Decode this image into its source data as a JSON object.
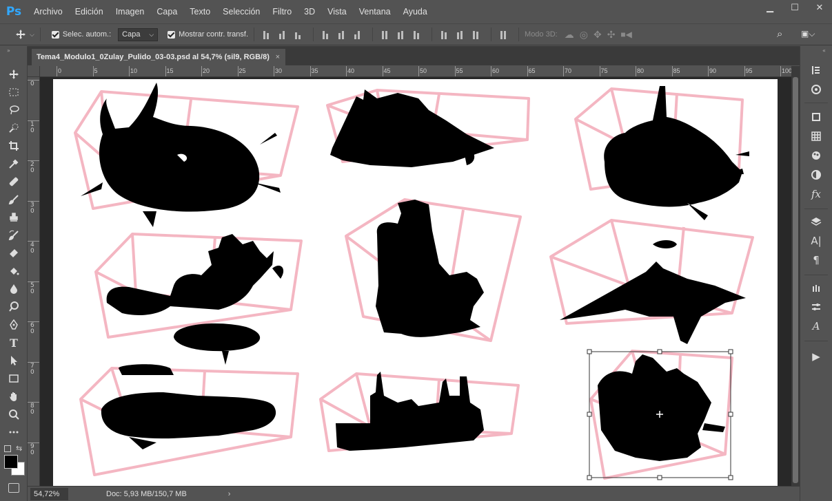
{
  "app": {
    "logo": "Ps",
    "brand_color": "#31a8ff"
  },
  "menu": [
    "Archivo",
    "Edición",
    "Imagen",
    "Capa",
    "Texto",
    "Selección",
    "Filtro",
    "3D",
    "Vista",
    "Ventana",
    "Ayuda"
  ],
  "window_controls": {
    "minimize": "▁",
    "maximize": "☐",
    "close": "✕"
  },
  "options": {
    "auto_select_label": "Selec. autom.:",
    "auto_select_checked": true,
    "auto_select_value": "Capa",
    "show_transform_label": "Mostrar contr. transf.",
    "show_transform_checked": true,
    "mode3d_label": "Modo 3D:"
  },
  "document": {
    "tab_title": "Tema4_Modulo1_0Zulay_Pulido_03-03.psd al 54,7% (sil9, RGB/8)",
    "close_glyph": "×"
  },
  "ruler": {
    "top_ticks": [
      "0",
      "5",
      "10",
      "15",
      "20",
      "25",
      "30",
      "35",
      "40",
      "45",
      "50",
      "55",
      "60",
      "65",
      "70",
      "75",
      "80",
      "85",
      "90",
      "95",
      "100"
    ],
    "left_ticks": [
      "0",
      "1 0",
      "2 0",
      "3 0",
      "4 0",
      "5 0",
      "6 0",
      "7 0",
      "8 0",
      "9 0"
    ]
  },
  "status": {
    "zoom": "54,72%",
    "doc_info": "Doc: 5,93 MB/150,7 MB",
    "arrow": "›"
  },
  "tools": [
    "move-tool",
    "marquee-tool",
    "lasso-tool",
    "quick-select-tool",
    "crop-tool",
    "eyedropper-tool",
    "healing-tool",
    "brush-tool",
    "stamp-tool",
    "history-brush-tool",
    "eraser-tool",
    "paint-bucket-tool",
    "blur-tool",
    "dodge-tool",
    "pen-tool",
    "type-tool",
    "path-select-tool",
    "rectangle-tool",
    "hand-tool",
    "zoom-tool",
    "more-tools"
  ],
  "tool_glyphs": {
    "type-tool": "T"
  },
  "colors": {
    "foreground": "#000000",
    "background": "#ffffff",
    "sketch_pink": "#f4b6c2"
  },
  "dock": {
    "glyphs": {
      "character": "A|",
      "paragraph": "¶",
      "fx": "fx",
      "glyph": "A",
      "play": "▶"
    }
  }
}
